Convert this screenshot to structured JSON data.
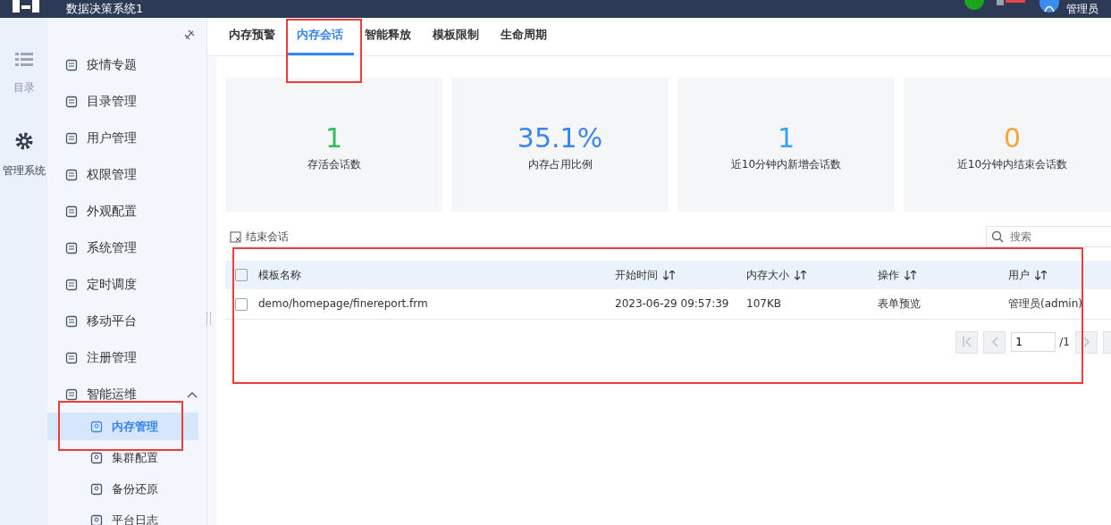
{
  "header": {
    "title": "数据决策系统1",
    "user": "管理员"
  },
  "rail": [
    {
      "label": "目录",
      "kind": "list",
      "selected": false
    },
    {
      "label": "管理系统",
      "kind": "gear",
      "selected": true
    }
  ],
  "sidebar": {
    "items": [
      {
        "label": "疫情专题",
        "kind": "item"
      },
      {
        "label": "目录管理",
        "kind": "item"
      },
      {
        "label": "用户管理",
        "kind": "item"
      },
      {
        "label": "权限管理",
        "kind": "item"
      },
      {
        "label": "外观配置",
        "kind": "item"
      },
      {
        "label": "系统管理",
        "kind": "item"
      },
      {
        "label": "定时调度",
        "kind": "item"
      },
      {
        "label": "移动平台",
        "kind": "item"
      },
      {
        "label": "注册管理",
        "kind": "item"
      },
      {
        "label": "智能运维",
        "kind": "group",
        "expanded": true,
        "children": [
          {
            "label": "内存管理",
            "selected": true
          },
          {
            "label": "集群配置",
            "selected": false
          },
          {
            "label": "备份还原",
            "selected": false
          },
          {
            "label": "平台日志",
            "selected": false
          }
        ]
      }
    ]
  },
  "tabs": [
    {
      "label": "内存预警",
      "selected": false
    },
    {
      "label": "内存会话",
      "selected": true
    },
    {
      "label": "智能释放",
      "selected": false
    },
    {
      "label": "模板限制",
      "selected": false
    },
    {
      "label": "生命周期",
      "selected": false
    }
  ],
  "stats": [
    {
      "value": "1",
      "label": "存活会话数",
      "color": "#2fbf5b"
    },
    {
      "value": "35.1%",
      "label": "内存占用比例",
      "color": "#3a86ef"
    },
    {
      "value": "1",
      "label": "近10分钟内新增会话数",
      "color": "#3aa2ef"
    },
    {
      "value": "0",
      "label": "近10分钟内结束会话数",
      "color": "#f5a53a"
    }
  ],
  "toolbar": {
    "end_session": "结束会话",
    "search": {
      "placeholder": "搜索"
    }
  },
  "table": {
    "header_checked": false,
    "columns": [
      {
        "label": "模板名称",
        "sortable": false
      },
      {
        "label": "开始时间",
        "sortable": true
      },
      {
        "label": "内存大小",
        "sortable": true
      },
      {
        "label": "操作",
        "sortable": true
      },
      {
        "label": "用户",
        "sortable": true
      }
    ],
    "rows": [
      {
        "checked": false,
        "cells": [
          "demo/homepage/finereport.frm",
          "2023-06-29 09:57:39",
          "107KB",
          "表单预览",
          "管理员(admin)"
        ]
      }
    ]
  },
  "pagination": {
    "page": "1",
    "total": "/1"
  }
}
